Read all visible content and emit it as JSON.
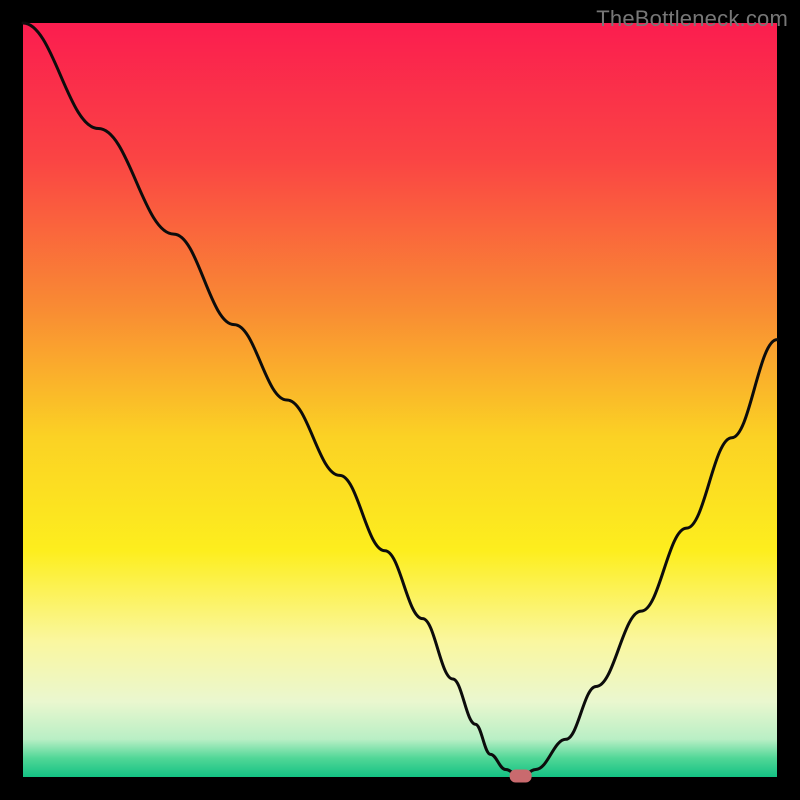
{
  "watermark": "TheBottleneck.com",
  "chart_data": {
    "type": "line",
    "title": "",
    "xlabel": "",
    "ylabel": "",
    "xlim": [
      0,
      100
    ],
    "ylim": [
      0,
      100
    ],
    "grid": false,
    "legend": false,
    "x": [
      0,
      10,
      20,
      28,
      35,
      42,
      48,
      53,
      57,
      60,
      62,
      64,
      66,
      68,
      72,
      76,
      82,
      88,
      94,
      100
    ],
    "values": [
      100,
      86,
      72,
      60,
      50,
      40,
      30,
      21,
      13,
      7,
      3,
      1,
      0,
      1,
      5,
      12,
      22,
      33,
      45,
      58
    ],
    "marker": {
      "x": 66,
      "y": 0,
      "color": "#c96a6e"
    },
    "gradient_stops": [
      {
        "offset": 0.0,
        "color": "#fb1d4f"
      },
      {
        "offset": 0.18,
        "color": "#fa4444"
      },
      {
        "offset": 0.38,
        "color": "#f98c33"
      },
      {
        "offset": 0.55,
        "color": "#fbd224"
      },
      {
        "offset": 0.7,
        "color": "#fdee1e"
      },
      {
        "offset": 0.82,
        "color": "#faf79f"
      },
      {
        "offset": 0.9,
        "color": "#eaf7cf"
      },
      {
        "offset": 0.95,
        "color": "#b9efc5"
      },
      {
        "offset": 0.975,
        "color": "#51d797"
      },
      {
        "offset": 1.0,
        "color": "#13c183"
      }
    ],
    "axis_color": "#000000",
    "axis_width": 23,
    "line_color": "#0c0c0c",
    "line_width": 3
  }
}
